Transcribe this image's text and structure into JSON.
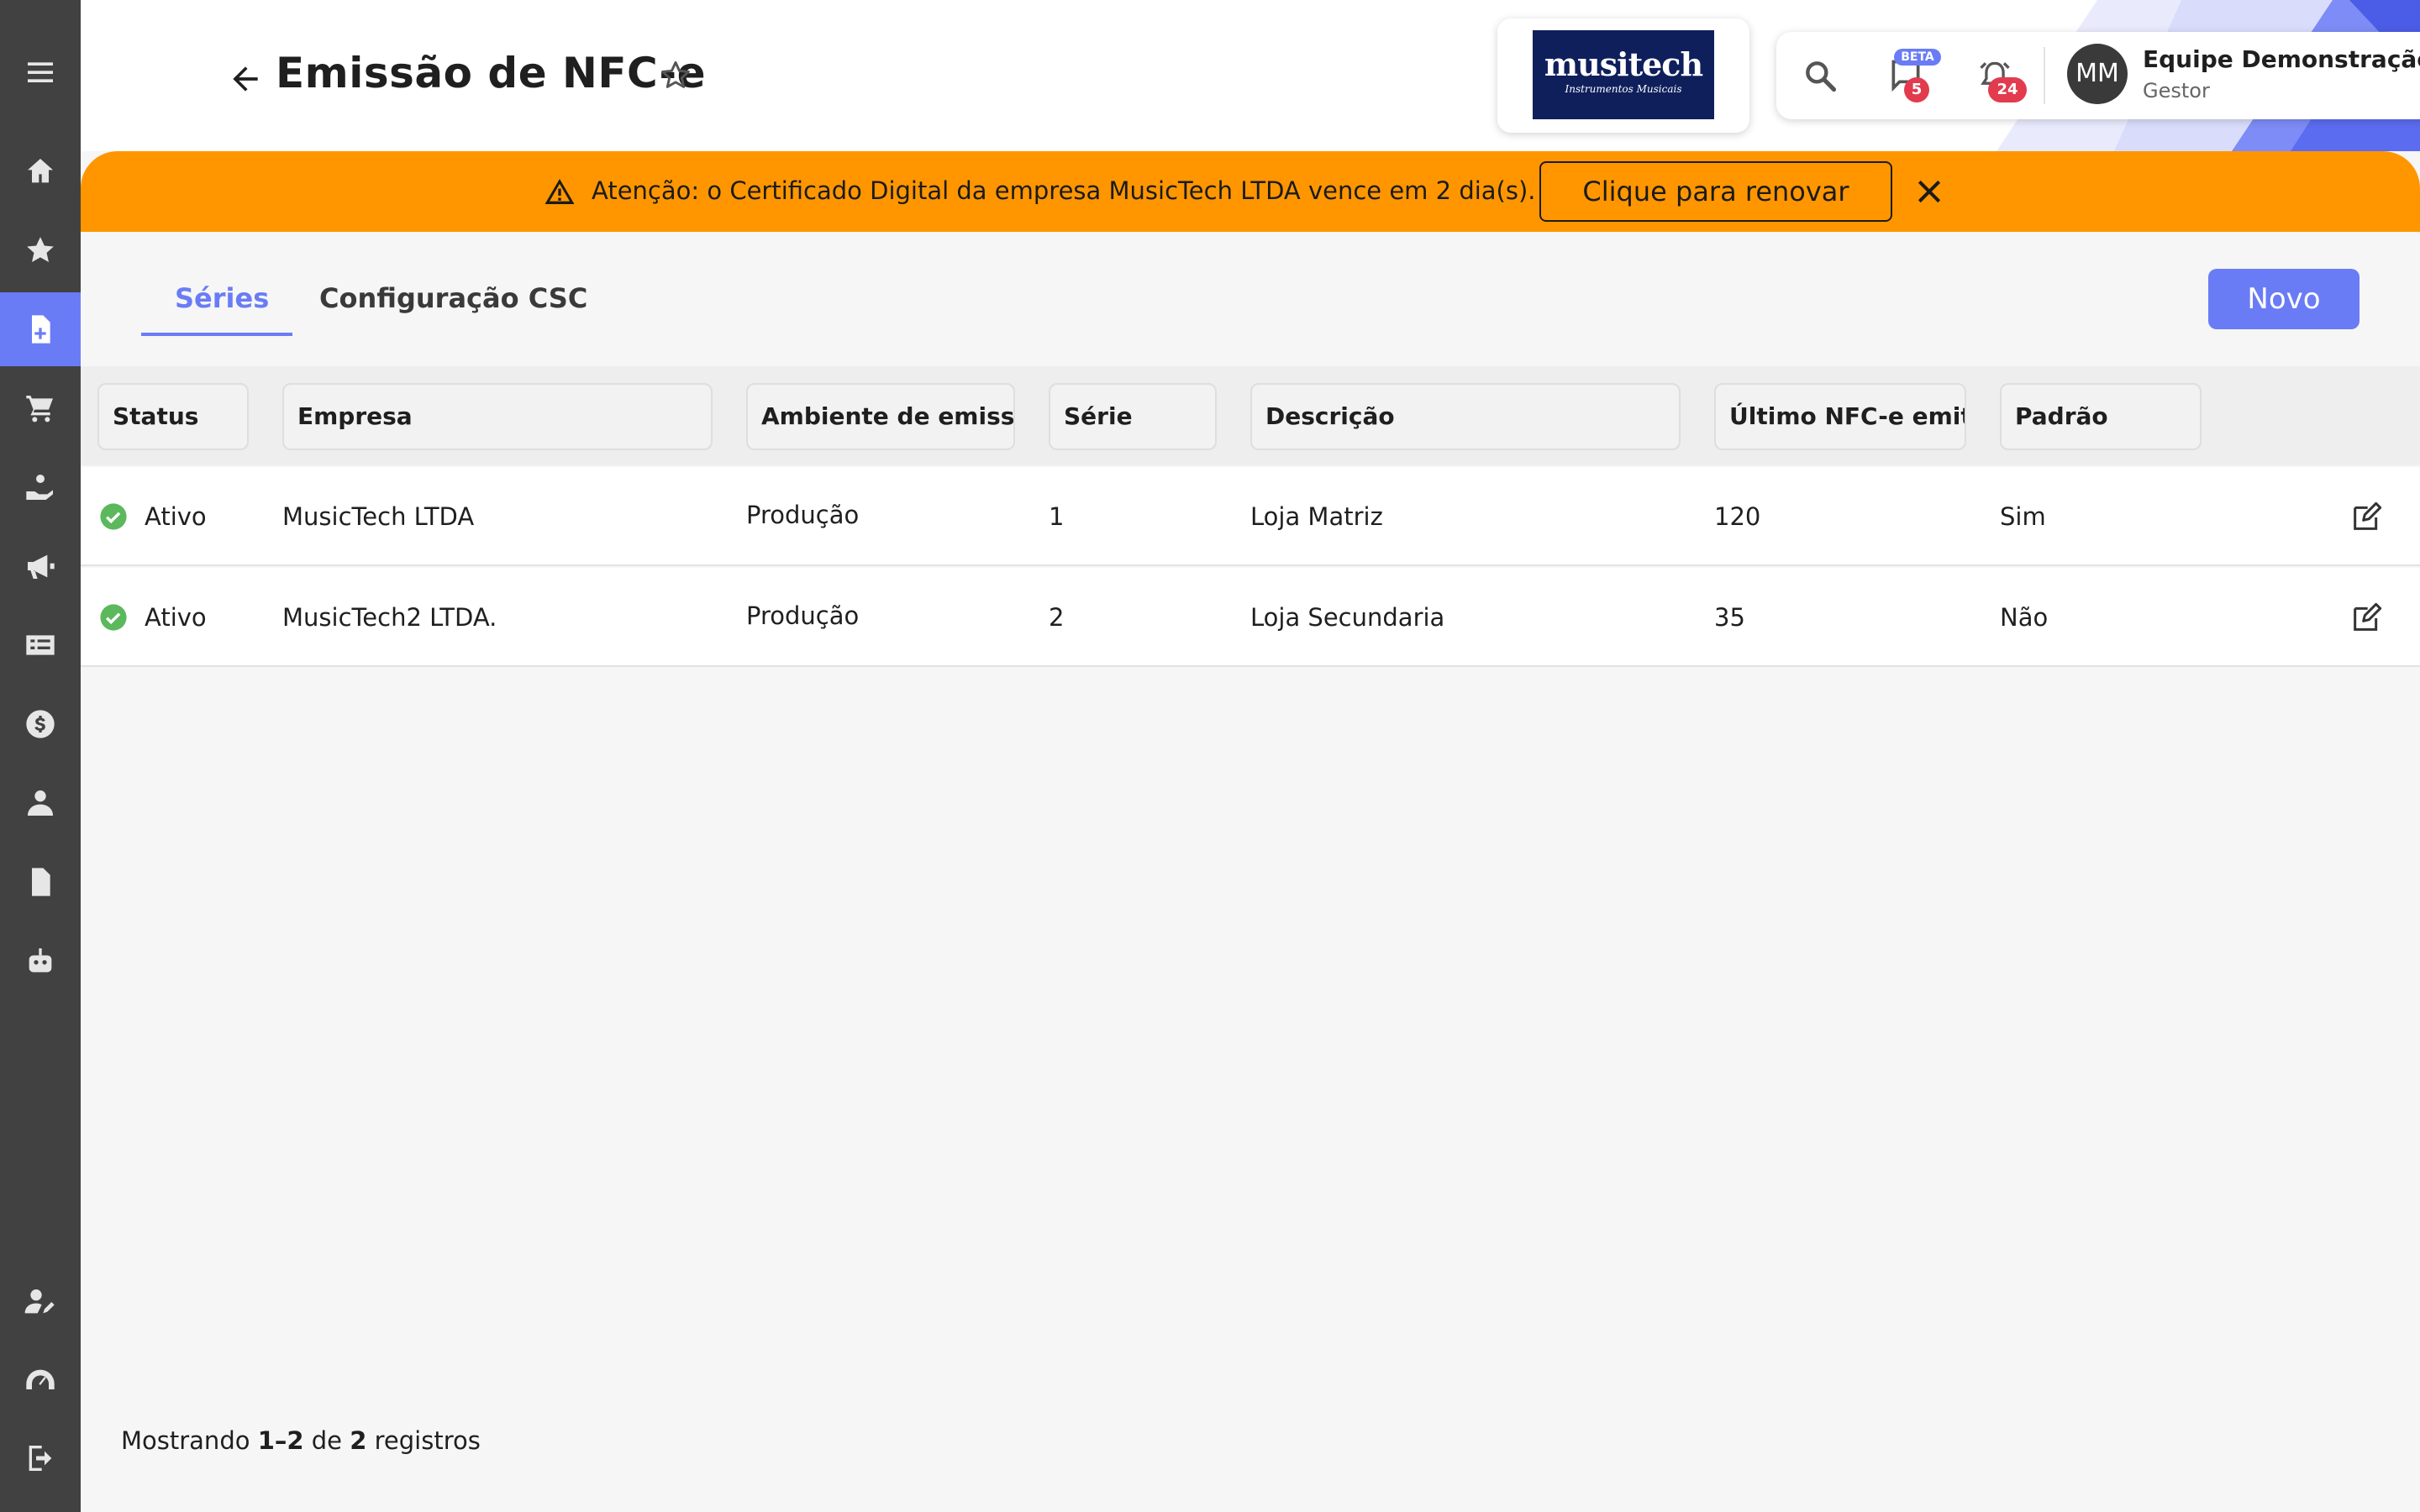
{
  "header": {
    "title": "Emissão de NFC-e",
    "logo": {
      "word": "musitech",
      "subtitle": "Instrumentos Musicais"
    },
    "chat_badge_label": "BETA",
    "chat_count": "5",
    "alerts_count": "24",
    "user": {
      "initials": "MM",
      "name": "Equipe Demonstração",
      "role": "Gestor"
    }
  },
  "alert": {
    "text": "Atenção: o Certificado Digital da empresa MusicTech LTDA vence em 2 dia(s).",
    "button_label": "Clique para renovar"
  },
  "tabs": [
    {
      "label": "Séries",
      "active": true
    },
    {
      "label": "Configuração CSC",
      "active": false
    }
  ],
  "new_button_label": "Novo",
  "table": {
    "headers": [
      "Status",
      "Empresa",
      "Ambiente de emissão",
      "Série",
      "Descrição",
      "Último NFC-e emitido",
      "Padrão"
    ],
    "rows": [
      {
        "status": "Ativo",
        "empresa": "MusicTech LTDA",
        "ambiente": "Produção",
        "serie": "1",
        "descricao": "Loja Matriz",
        "ultimo": "120",
        "padrao": "Sim"
      },
      {
        "status": "Ativo",
        "empresa": "MusicTech2 LTDA.",
        "ambiente": "Produção",
        "serie": "2",
        "descricao": "Loja Secundaria",
        "ultimo": "35",
        "padrao": "Não"
      }
    ]
  },
  "footer": {
    "prefix": "Mostrando",
    "range": "1–2",
    "of": "de",
    "total": "2",
    "suffix": "registros"
  },
  "colors": {
    "accent": "#6a7cf5",
    "alert": "#ff9600",
    "sidebar": "#414141",
    "status_ok": "#5cb85c",
    "badge": "#e23b4e"
  },
  "icons": {
    "sidebar": [
      "menu-icon",
      "home-icon",
      "star-icon",
      "document-add-icon",
      "cart-icon",
      "hand-coins-icon",
      "megaphone-icon",
      "receipt-icon",
      "dollar-icon",
      "user-icon",
      "file-icon",
      "robot-icon",
      "user-edit-icon",
      "speedometer-icon",
      "logout-icon"
    ]
  }
}
